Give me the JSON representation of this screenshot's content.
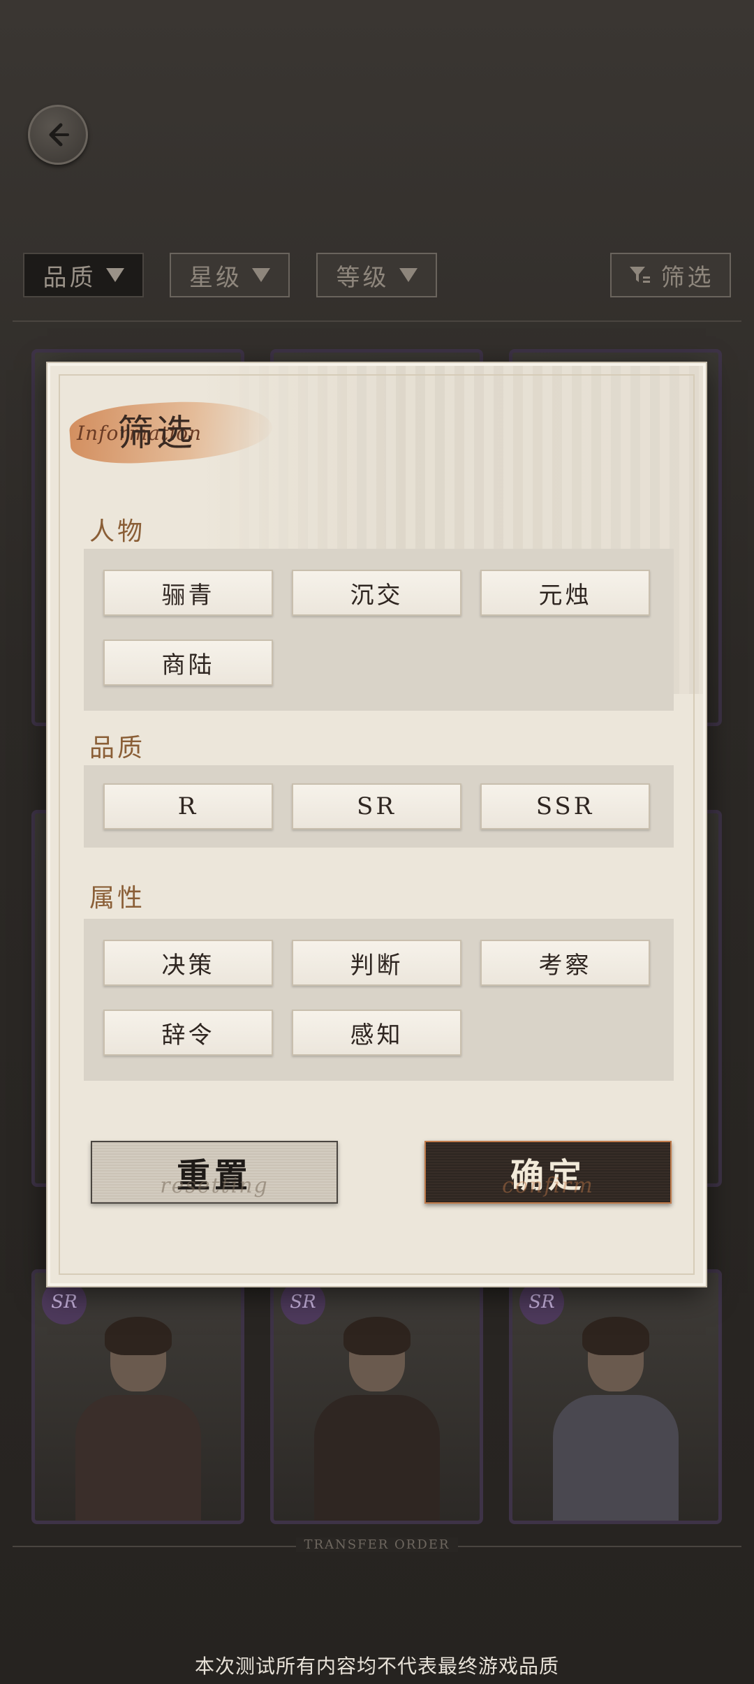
{
  "filter_bar": {
    "tabs": [
      {
        "label": "品质",
        "active": true
      },
      {
        "label": "星级",
        "active": false
      },
      {
        "label": "等级",
        "active": false
      }
    ],
    "filter_button_label": "筛选"
  },
  "cards": {
    "badge": "SR"
  },
  "footer": {
    "transfer_label": "TRANSFER ORDER",
    "disclaimer": "本次测试所有内容均不代表最终游戏品质"
  },
  "modal": {
    "title": "筛选",
    "title_script": "Information",
    "sections": [
      {
        "label": "人物",
        "options": [
          "骊青",
          "沉交",
          "元烛",
          "商陆"
        ]
      },
      {
        "label": "品质",
        "options": [
          "R",
          "SR",
          "SSR"
        ]
      },
      {
        "label": "属性",
        "options": [
          "决策",
          "判断",
          "考察",
          "辞令",
          "感知"
        ]
      }
    ],
    "reset": {
      "label": "重置",
      "sub": "resetting"
    },
    "confirm": {
      "label": "确定",
      "sub": "confirm"
    }
  },
  "colors": {
    "accent": "#8a5e36",
    "modal_bg": "#ece6da",
    "confirm_bg": "#2e2621",
    "sr_badge": "#4e3a5c"
  }
}
